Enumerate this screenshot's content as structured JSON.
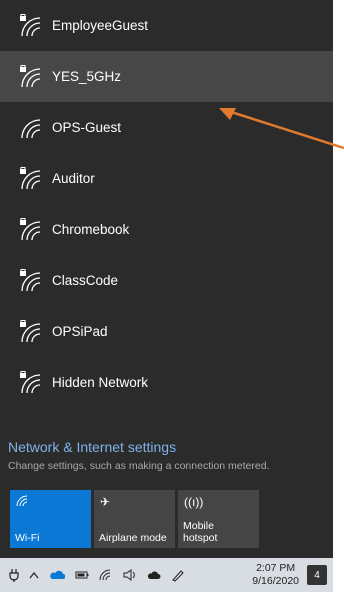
{
  "networks": [
    {
      "name": "EmployeeGuest",
      "secured": true
    },
    {
      "name": "YES_5GHz",
      "secured": true,
      "selected": true
    },
    {
      "name": "OPS-Guest",
      "secured": false
    },
    {
      "name": "Auditor",
      "secured": true
    },
    {
      "name": "Chromebook",
      "secured": true
    },
    {
      "name": "ClassCode",
      "secured": true
    },
    {
      "name": "OPSiPad",
      "secured": true
    },
    {
      "name": "Hidden Network",
      "secured": true
    }
  ],
  "settings": {
    "title": "Network & Internet settings",
    "subtitle": "Change settings, such as making a connection metered."
  },
  "tiles": {
    "wifi": {
      "label": "Wi-Fi",
      "icon": "wifi-icon"
    },
    "airplane": {
      "label": "Airplane mode",
      "icon": "airplane-icon"
    },
    "hotspot": {
      "label": "Mobile\nhotspot",
      "icon": "hotspot-icon"
    }
  },
  "taskbar": {
    "time": "2:07 PM",
    "date": "9/16/2020",
    "notification_count": "4"
  },
  "colors": {
    "panel_bg": "#2b2b2b",
    "accent": "#0a78d4",
    "link": "#7fb3e8",
    "annotation_arrow": "#e07a2e"
  }
}
